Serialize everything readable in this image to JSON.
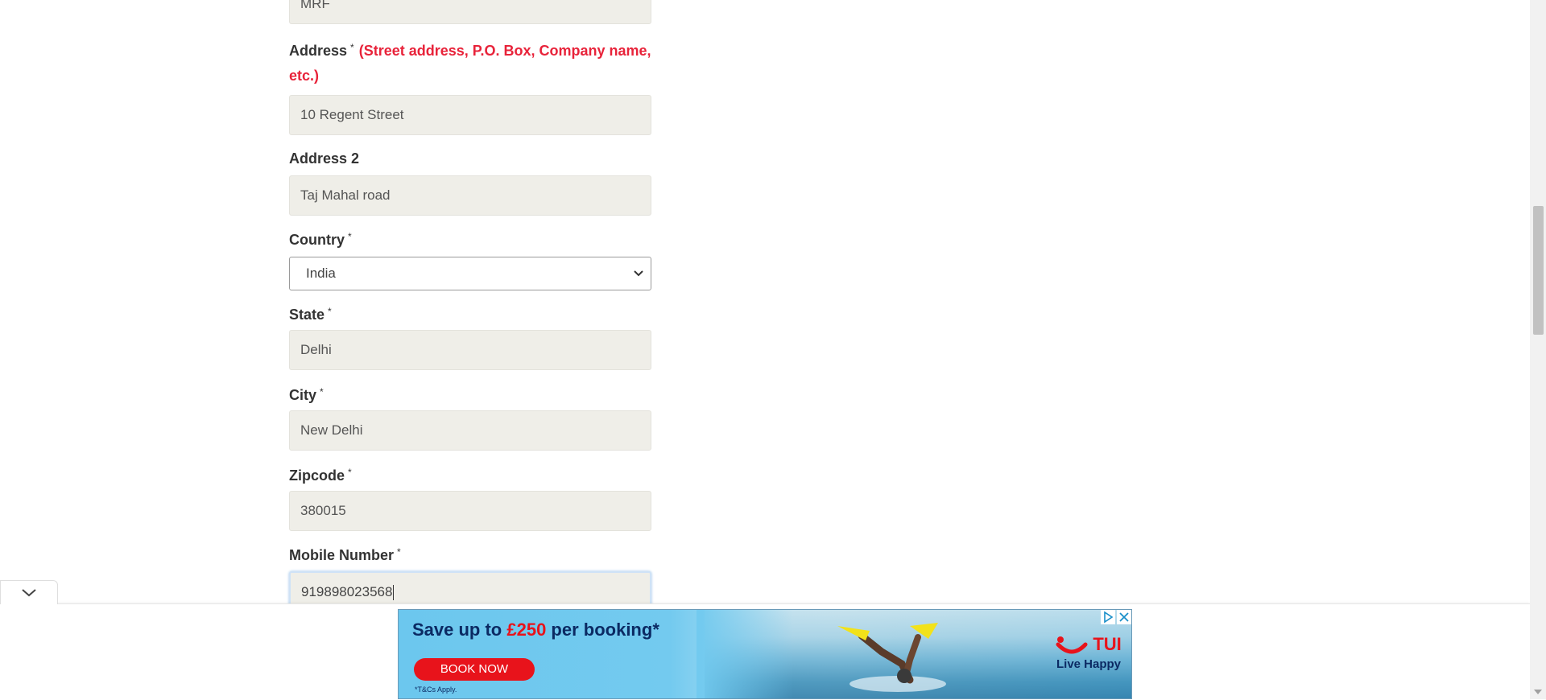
{
  "form": {
    "company_value": "MRF",
    "address_label": "Address",
    "address_required": "*",
    "address_hint": "(Street address, P.O. Box, Company name, etc.)",
    "address_value": "10 Regent Street",
    "address2_label": "Address 2",
    "address2_value": "Taj Mahal road",
    "country_label": "Country",
    "country_required": "*",
    "country_value": "India",
    "state_label": "State",
    "state_required": "*",
    "state_value": "Delhi",
    "city_label": "City",
    "city_required": "*",
    "city_value": "New Delhi",
    "zipcode_label": "Zipcode",
    "zipcode_required": "*",
    "zipcode_value": "380015",
    "mobile_label": "Mobile Number",
    "mobile_required": "*",
    "mobile_value": "919898023568"
  },
  "ad": {
    "headline_pre": "Save up to ",
    "headline_amount": "£250",
    "headline_post": " per booking*",
    "button_label": "BOOK NOW",
    "terms": "*T&Cs Apply.",
    "brand": "TUI",
    "tagline": "Live Happy",
    "colors": {
      "brand_red": "#e8131b",
      "brand_navy": "#0b2a63",
      "sky": "#6cc7ee"
    }
  },
  "icons": {
    "collapse": "chevron-down-icon",
    "adchoices": "adchoices-icon",
    "close": "close-icon",
    "tui_smile": "tui-smile-logo"
  },
  "colors": {
    "field_bg": "#efeee8",
    "required_hint": "#e8233a"
  }
}
